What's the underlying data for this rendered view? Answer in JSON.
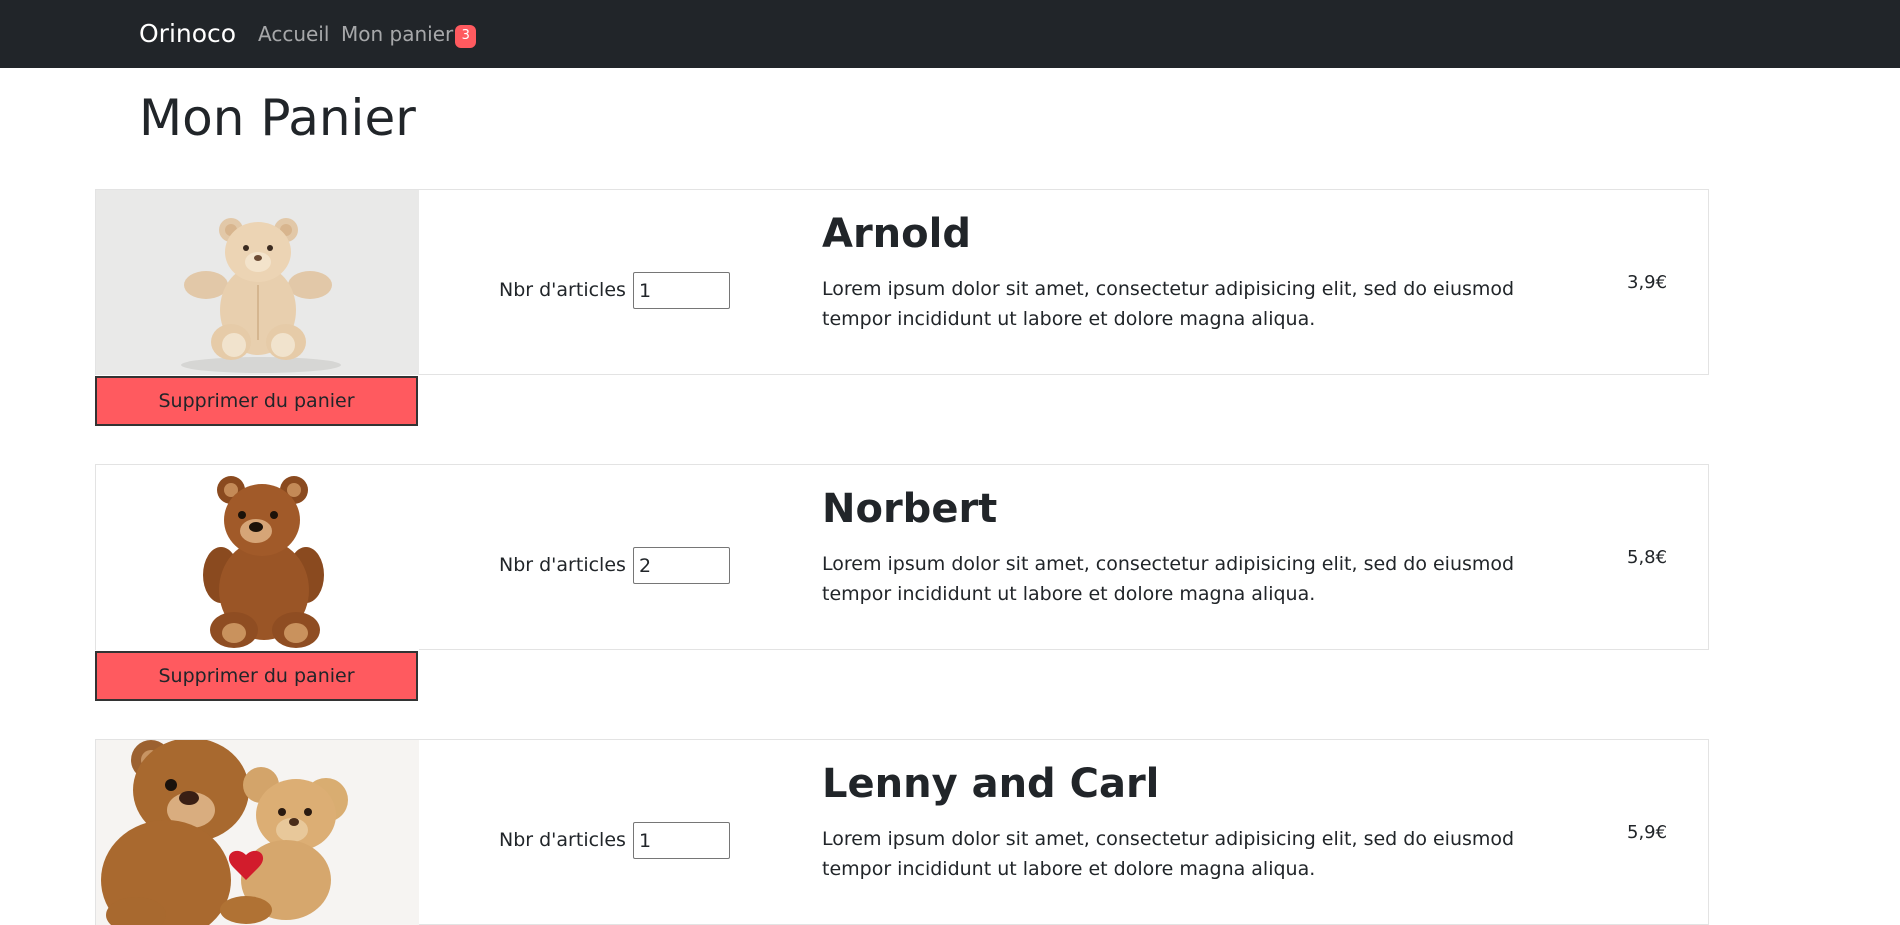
{
  "navbar": {
    "brand": "Orinoco",
    "links": [
      {
        "label": "Accueil"
      },
      {
        "label": "Mon panier",
        "badge": "3"
      }
    ],
    "background": "#212529",
    "badge_color": "#ff5a5f"
  },
  "page": {
    "title": "Mon Panier"
  },
  "cart": {
    "quantity_label": "Nbr d'articles :",
    "remove_label": "Supprimer du panier",
    "remove_color": "#ff5a5f",
    "items": [
      {
        "name": "Arnold",
        "description": "Lorem ipsum dolor sit amet, consectetur adipisicing elit, sed do eiusmod tempor incididunt ut labore et dolore magna aliqua.",
        "quantity": "1",
        "price": "3,9€",
        "image": "teddy-bear-beige-icon"
      },
      {
        "name": "Norbert",
        "description": "Lorem ipsum dolor sit amet, consectetur adipisicing elit, sed do eiusmod tempor incididunt ut labore et dolore magna aliqua.",
        "quantity": "2",
        "price": "5,8€",
        "image": "teddy-bear-brown-icon"
      },
      {
        "name": "Lenny and Carl",
        "description": "Lorem ipsum dolor sit amet, consectetur adipisicing elit, sed do eiusmod tempor incididunt ut labore et dolore magna aliqua.",
        "quantity": "1",
        "price": "5,9€",
        "image": "teddy-bears-pair-icon"
      }
    ]
  }
}
